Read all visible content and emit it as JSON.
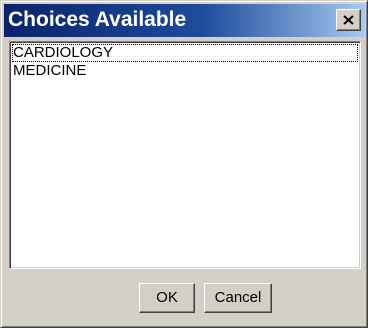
{
  "window": {
    "title": "Choices Available",
    "close_icon": "close-icon"
  },
  "list": {
    "items": [
      {
        "label": "CARDIOLOGY",
        "focused": true
      },
      {
        "label": "MEDICINE",
        "focused": false
      }
    ]
  },
  "buttons": {
    "ok_label": "OK",
    "cancel_label": "Cancel"
  },
  "colors": {
    "titlebar_start": "#0a246a",
    "titlebar_end": "#a6caf0",
    "face": "#d4d0c8",
    "list_background": "#ffffff"
  }
}
